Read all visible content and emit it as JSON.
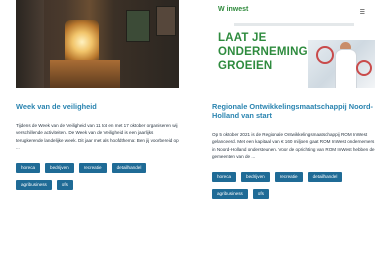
{
  "cards": [
    {
      "title": "Week van de veiligheid",
      "body": "Tijdens de Week van de Veiligheid van 11 tot en met 17 oktober organiseren wij verschillende activiteiten. De Week van de Veiligheid is een jaarlijks terugkerende landelijke week. Dit jaar met als hoofdthema: Ben jij voorbereid op ...",
      "tags": [
        "horeca",
        "bedrijven",
        "recreatie",
        "detailhandel",
        "agribusiness",
        "ofs"
      ]
    },
    {
      "title": "Regionale Ontwikkelingsmaatschappij Noord-Holland van start",
      "body": "Op 5 oktober 2021 is de Regionale Ontwikkelingsmaatschappij ROM InWest gelanceerd. Met een kapitaal van € 160 miljoen gaat ROM InWest ondernemers in Noord-Holland ondersteunen. Voor de oprichting van ROM InWest hebben de gemeenten van de ...",
      "tags": [
        "horeca",
        "bedrijven",
        "recreatie",
        "detailhandel",
        "agribusiness",
        "ofs"
      ],
      "image": {
        "logo": "inwest",
        "headline_line1": "LAAT JE",
        "headline_line2": "ONDERNEMING",
        "headline_line3": "GROEIEN"
      }
    }
  ],
  "icons": {
    "menu": "hamburger-icon"
  },
  "colors": {
    "title": "#2a84b0",
    "tag_bg": "#1f6b96",
    "headline_green": "#2e8b3e"
  }
}
